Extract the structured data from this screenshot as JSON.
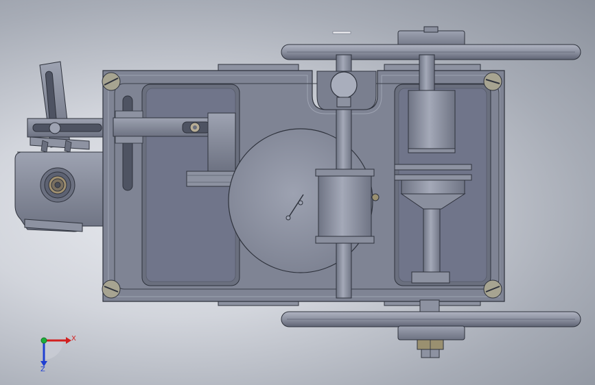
{
  "viewport": {
    "background_center": "#e8eaef",
    "background_edge": "#8b919c"
  },
  "colors": {
    "part_fill": "#7f8494",
    "part_light": "#9a9fae",
    "part_dark": "#5c6170",
    "edge": "#2e323c",
    "axis_x": "#d21f1f",
    "axis_y": "#1fae3a",
    "axis_z": "#1f3fd2"
  },
  "triad": {
    "x_label": "X",
    "z_label": "Z"
  }
}
